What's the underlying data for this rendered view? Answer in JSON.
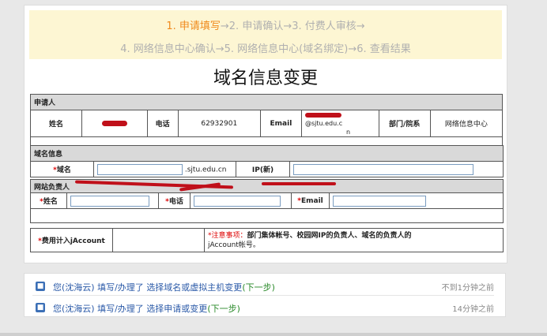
{
  "steps": {
    "active": "1. 申请填写",
    "line1_rest": "→2. 申请确认→3. 付费人审核→",
    "line2": "4. 网络信息中心确认→5. 网络信息中心(域名绑定)→6. 查看结果"
  },
  "form": {
    "title": "域名信息变更",
    "applicant": {
      "section": "申请人",
      "name_label": "姓名",
      "phone_label": "电话",
      "phone_value": "62932901",
      "email_label": "Email",
      "email_line1": "@sjtu.edu.c",
      "email_line2": "n",
      "dept_label": "部门/院系",
      "dept_value": "网络信息中心"
    },
    "domain": {
      "section": "域名信息",
      "req_mark": "*",
      "domain_label": "域名",
      "suffix": ".sjtu.edu.cn",
      "ip_label": "IP(新)"
    },
    "site_owner": {
      "section": "网站负责人",
      "req_mark": "*",
      "name_label": "姓名",
      "phone_label": "电话",
      "email_label": "Email"
    },
    "billing": {
      "req_mark": "*",
      "label": "费用计入jAccount",
      "notice_label": "*注意事项：",
      "notice_text": "部门集体帐号、校园网IP的负责人、域名的负责人的",
      "notice_text2": "jAccount帐号。"
    }
  },
  "activity": [
    {
      "user": "您(沈海云)",
      "verb": "填写/办理了",
      "action": "选择域名或虚拟主机变更",
      "next": "(下一步)",
      "time": "不到1分钟之前"
    },
    {
      "user": "您(沈海云)",
      "verb": "填写/办理了",
      "action": "选择申请或变更",
      "next": "(下一步)",
      "time": "14分钟之前"
    }
  ],
  "icons": {
    "activity_icon": "user-icon"
  },
  "colors": {
    "accent": "#f08a1c",
    "link": "#2b5aa8",
    "next": "#2a8a2a",
    "redaction": "#c0101a"
  }
}
